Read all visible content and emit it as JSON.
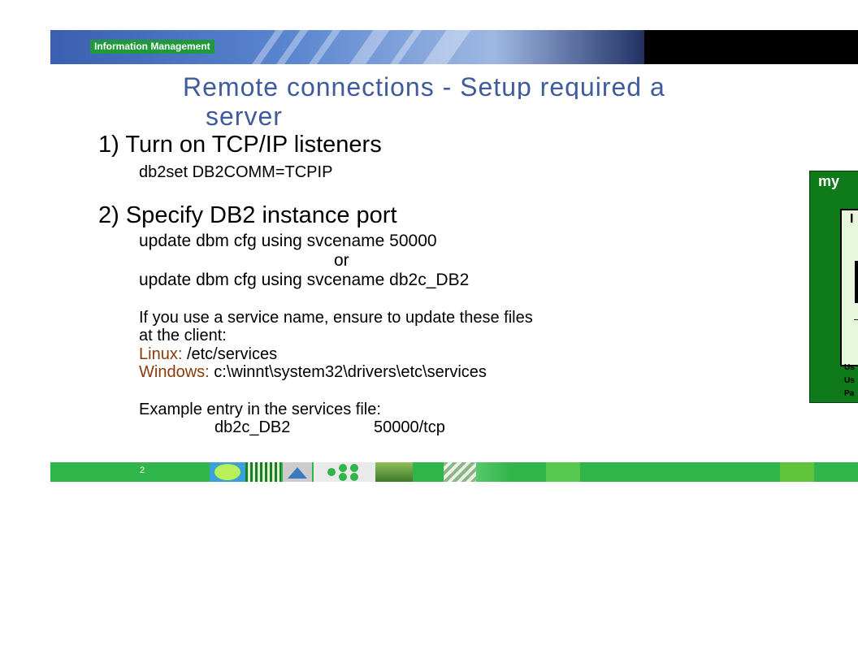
{
  "header": {
    "brand_tag": "Information Management"
  },
  "title": {
    "line1": "Remote connections - Setup required a",
    "line2": "server"
  },
  "steps": [
    {
      "heading": "1) Turn on TCP/IP listeners",
      "lines": [
        "db2set DB2COMM=TCPIP"
      ]
    },
    {
      "heading": "2) Specify DB2 instance port",
      "lines": [
        "update dbm cfg using svcename 50000",
        "or",
        "update dbm cfg using svcename db2c_DB2"
      ]
    }
  ],
  "note": {
    "line1": "If you use a service name, ensure to update these files",
    "line2": "at the client:",
    "linux_label": "Linux:",
    "linux_path": "/etc/services",
    "windows_label": "Windows:",
    "windows_path": "c:\\winnt\\system32\\drivers\\etc\\services"
  },
  "example": {
    "label": "Example entry in the services file:",
    "service": "db2c_DB2",
    "port": "50000/tcp"
  },
  "panel": {
    "title": "my",
    "inner_letter": "I",
    "inner_dash": "–",
    "labels": [
      "Us",
      "Us",
      "Pa"
    ]
  },
  "footer": {
    "page": "2"
  },
  "colors": {
    "title": "#3f5b9e",
    "brand_green": "#1f9a3a",
    "footer_green": "#2fb54a",
    "panel_green": "#0e7a1a",
    "label_brown": "#8a3a0a"
  }
}
